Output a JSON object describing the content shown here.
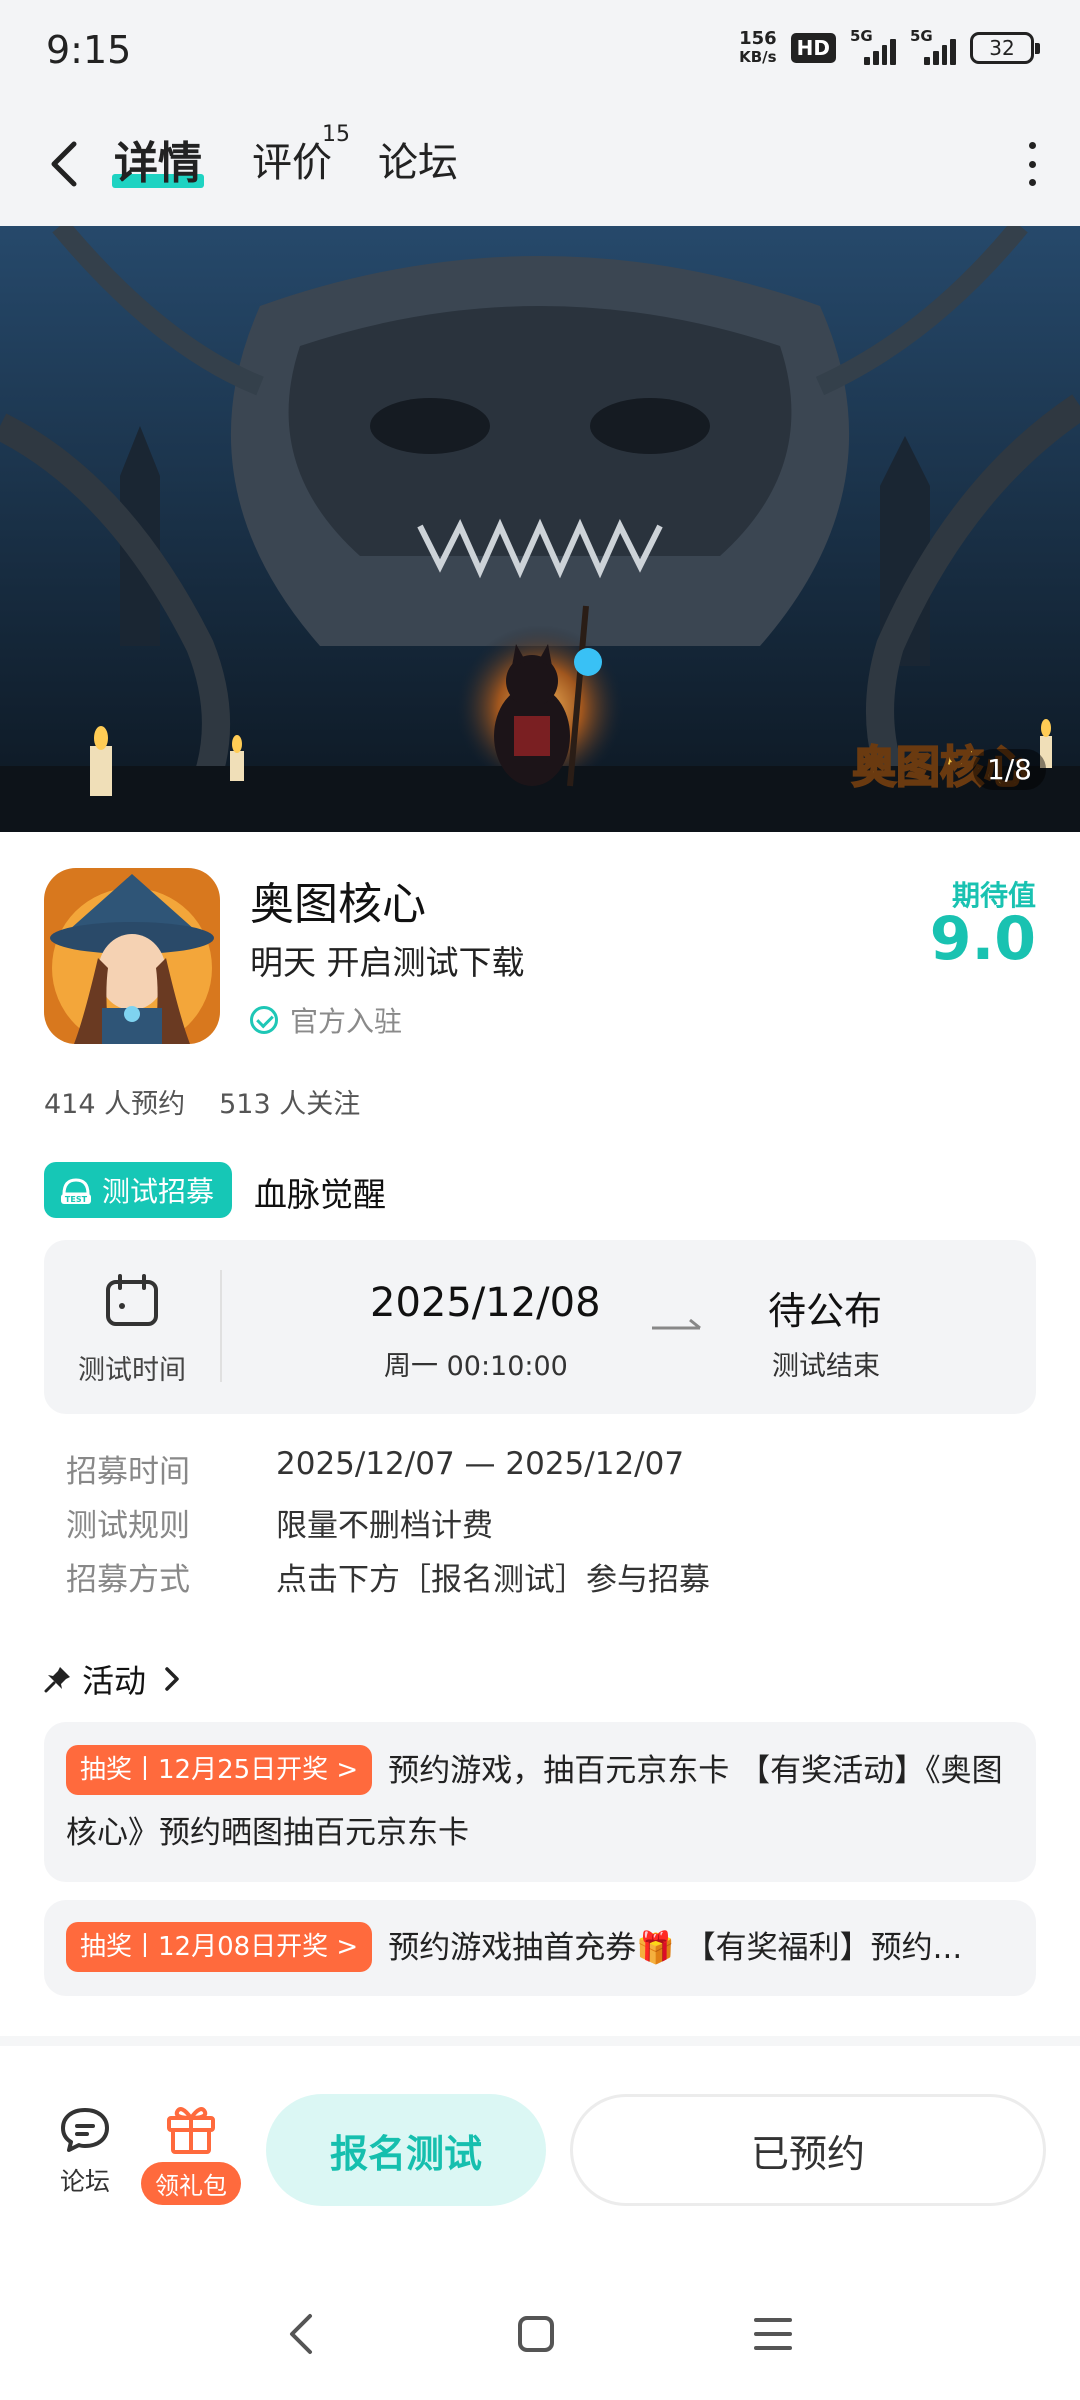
{
  "status": {
    "time": "9:15",
    "net_speed_value": "156",
    "net_speed_unit": "KB/s",
    "hd": "HD",
    "signal_label_1": "5G",
    "signal_label_2": "5G",
    "battery": "32"
  },
  "nav": {
    "tabs": [
      {
        "label": "详情",
        "active": true
      },
      {
        "label": "评价",
        "superscript": "15"
      },
      {
        "label": "论坛"
      }
    ]
  },
  "banner": {
    "counter": "1/8",
    "logo_text": "奥图核心"
  },
  "app": {
    "name": "奥图核心",
    "subtitle": "明天 开启测试下载",
    "official": "官方入驻",
    "expect_label": "期待值",
    "expect_score": "9.0",
    "reservations": "414 人预约",
    "followers": "513 人关注"
  },
  "test": {
    "badge": "测试招募",
    "badge_icon_text": "TEST",
    "title": "血脉觉醒",
    "time_label": "测试时间",
    "start_date": "2025/12/08",
    "start_time": "周一  00:10:00",
    "end_status": "待公布",
    "end_label": "测试结束"
  },
  "info": [
    {
      "key": "招募时间",
      "value": "2025/12/07 — 2025/12/07"
    },
    {
      "key": "测试规则",
      "value": "限量不删档计费"
    },
    {
      "key": "招募方式",
      "value": "点击下方［报名测试］参与招募"
    }
  ],
  "activities": {
    "header": "活动",
    "items": [
      {
        "tag": "抽奖丨12月25日开奖 >",
        "text": "预约游戏，抽百元京东卡 【有奖活动】《奥图核心》预约晒图抽百元京东卡"
      },
      {
        "tag": "抽奖丨12月08日开奖 >",
        "text": "预约游戏抽首充券🎁 【有奖福利】预约..."
      }
    ]
  },
  "bottom": {
    "forum": "论坛",
    "gift": "领礼包",
    "signup": "报名测试",
    "reserved": "已预约"
  },
  "colors": {
    "accent": "#16c7b6",
    "orange": "#ff6a3d"
  }
}
